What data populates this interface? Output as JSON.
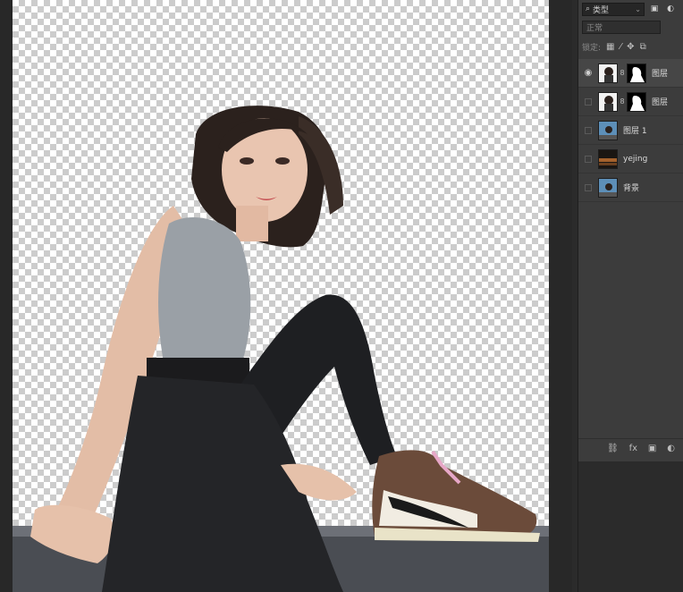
{
  "panel": {
    "filter_kind": "类型",
    "blend_mode": "正常",
    "lock_label": "锁定:",
    "layers": [
      {
        "name": "图层",
        "visible": true,
        "has_mask": true
      },
      {
        "name": "图层",
        "visible": false,
        "has_mask": true
      },
      {
        "name": "图层 1",
        "visible": false,
        "has_mask": false
      },
      {
        "name": "yejing",
        "visible": false,
        "has_mask": false
      },
      {
        "name": "背景",
        "visible": false,
        "has_mask": false
      }
    ],
    "footer": [
      "⛓",
      "fx",
      "▣",
      "◐"
    ]
  },
  "colors": {
    "canvas_bg": "#282828",
    "panel_bg": "#3c3c3c",
    "checker_light": "#ffffff",
    "checker_dark": "#cccccc"
  }
}
